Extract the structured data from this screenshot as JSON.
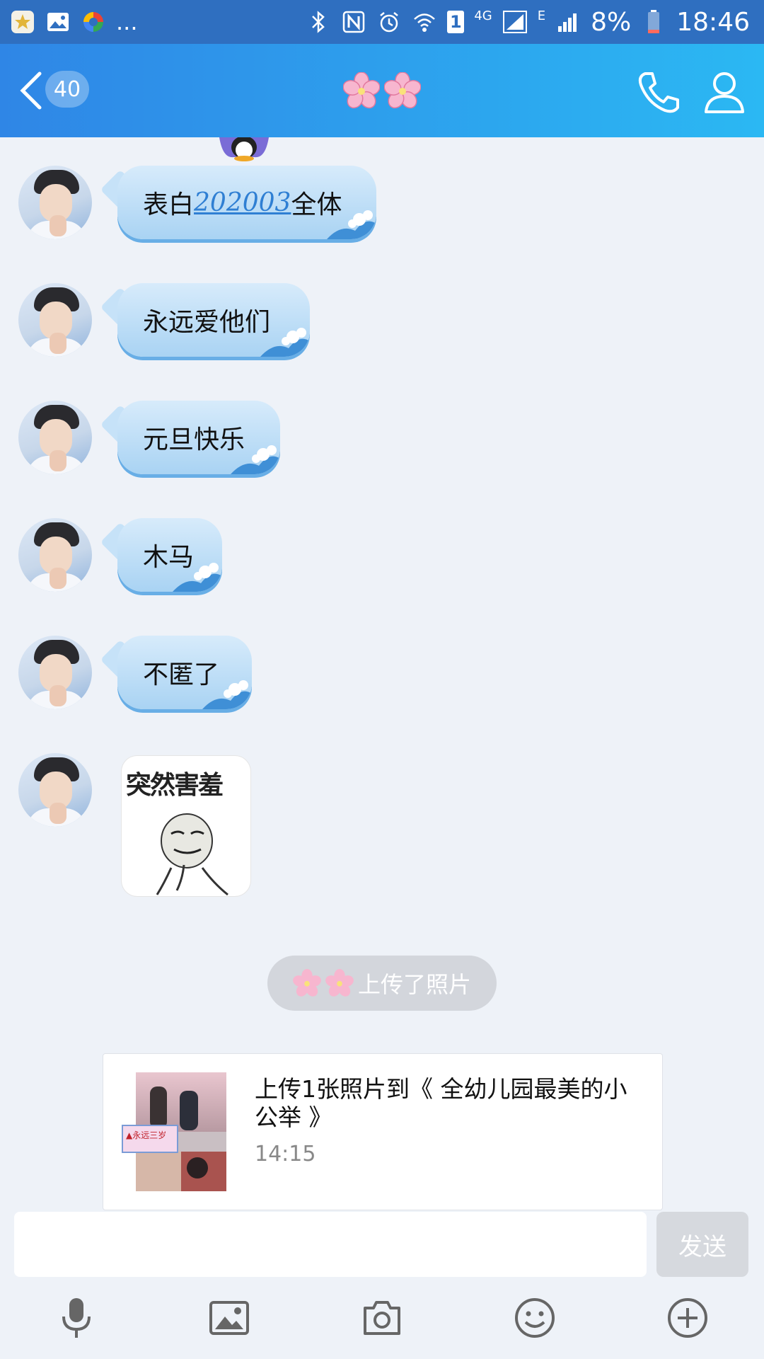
{
  "status_bar": {
    "app_icons": [
      "star-app-icon",
      "gallery-icon",
      "colorful-app-icon"
    ],
    "more": "...",
    "network_4g": "4G",
    "network_e": "E",
    "sim_slot": "1",
    "battery": "8%",
    "time": "18:46"
  },
  "header": {
    "unread_count": "40",
    "title_icons": [
      "cherry-blossom-icon",
      "cherry-blossom-icon"
    ]
  },
  "messages": [
    {
      "type": "text",
      "parts": [
        "表白",
        "202003",
        "全体"
      ]
    },
    {
      "type": "text",
      "text": "永远爱他们"
    },
    {
      "type": "text",
      "text": "元旦快乐"
    },
    {
      "type": "text",
      "text": "木马"
    },
    {
      "type": "text",
      "text": "不匿了"
    },
    {
      "type": "sticker",
      "caption": "突然害羞"
    }
  ],
  "system_notice": {
    "text": "上传了照片"
  },
  "upload_card": {
    "title": "上传1张照片到《 全幼儿园最美的小公举 》",
    "time": "14:15",
    "thumb_label": "▲永远三岁"
  },
  "composer": {
    "input_value": "",
    "send_label": "发送"
  },
  "toolbar": [
    "microphone-icon",
    "image-icon",
    "camera-icon",
    "emoji-icon",
    "plus-icon"
  ],
  "colors": {
    "status_bar": "#2f6fc0",
    "header_start": "#2f86e6",
    "header_end": "#2bb8f3",
    "bubble": "#a9d3f3",
    "background": "#eef2f8",
    "link": "#2f7fd3"
  }
}
